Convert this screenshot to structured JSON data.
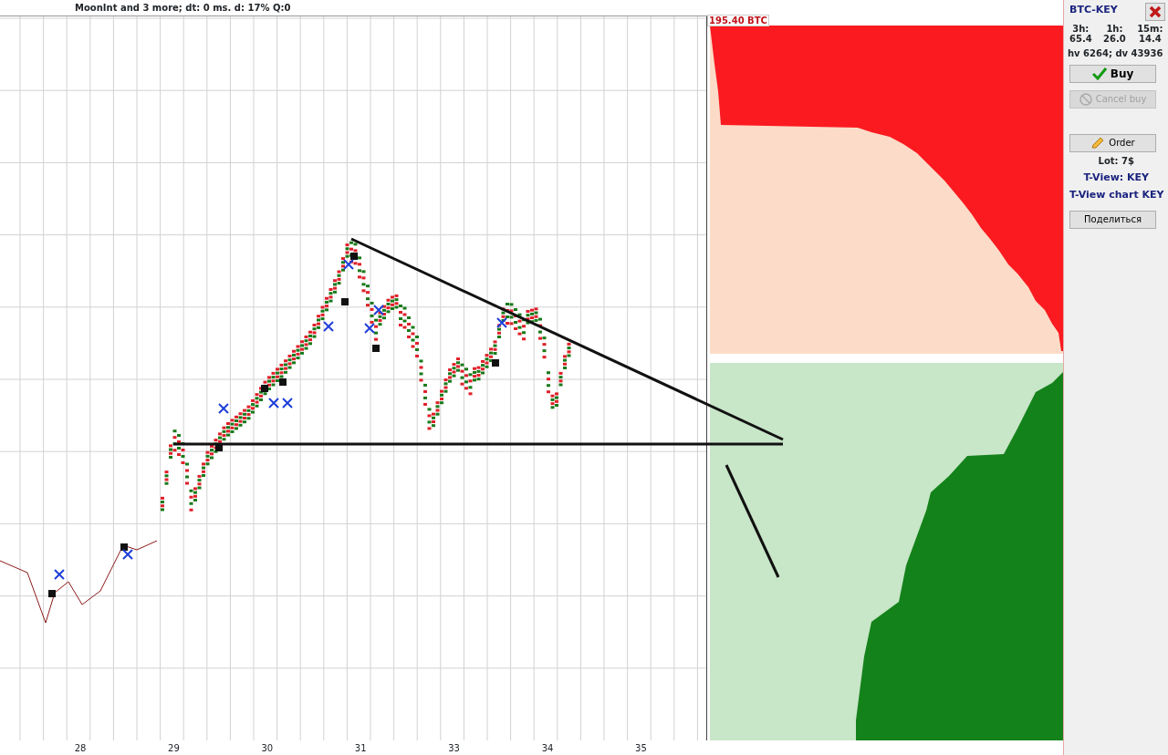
{
  "status_bar": {
    "text": "MoonInt and 3 more;   dt: 0 ms.   d: 17% Q:0"
  },
  "depth": {
    "label": "195.40 BTC"
  },
  "x_axis": {
    "labels": [
      "28",
      "29",
      "30",
      "31",
      "33",
      "34",
      "35"
    ]
  },
  "panel": {
    "title": "BTC-KEY",
    "stats": [
      {
        "label": "3h:",
        "value": "65.4"
      },
      {
        "label": "1h:",
        "value": "26.0"
      },
      {
        "label": "15m:",
        "value": "14.4"
      }
    ],
    "volume": "hv 6264; dv 43936",
    "buttons": [
      {
        "kind": "buy",
        "label": "Buy",
        "disabled": false
      },
      {
        "kind": "cancel",
        "label": "Cancel buy",
        "disabled": true
      },
      {
        "kind": "order",
        "label": "Order",
        "disabled": false
      }
    ],
    "lot": "Lot: 7$",
    "links": [
      "T-View: KEY",
      "T-View chart KEY"
    ],
    "share": {
      "label": "Поделиться",
      "disabled": false
    }
  }
}
